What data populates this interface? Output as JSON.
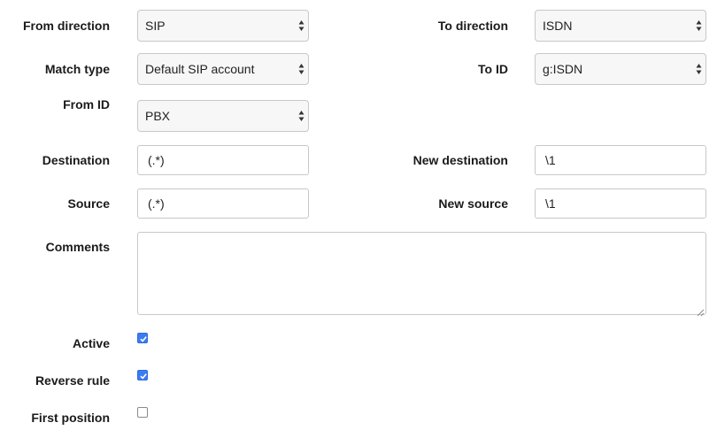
{
  "labels": {
    "from_direction": "From direction",
    "to_direction": "To direction",
    "match_type": "Match type",
    "to_id": "To ID",
    "from_id": "From ID",
    "destination": "Destination",
    "new_destination": "New destination",
    "source": "Source",
    "new_source": "New source",
    "comments": "Comments",
    "active": "Active",
    "reverse_rule": "Reverse rule",
    "first_position": "First position"
  },
  "fields": {
    "from_direction": "SIP",
    "to_direction": "ISDN",
    "match_type": "Default SIP account",
    "to_id": "g:ISDN",
    "from_id": "PBX",
    "destination": "(.*)",
    "new_destination": "\\1",
    "source": "(.*)",
    "new_source": "\\1",
    "comments": ""
  },
  "checkboxes": {
    "active": true,
    "reverse_rule": true,
    "first_position": false
  },
  "icons": {
    "select_arrows": "updown-arrows-icon",
    "check": "check-icon",
    "resize": "resize-grip-icon"
  },
  "colors": {
    "checkbox_checked": "#3b7cf5",
    "border": "#c8c8c8"
  }
}
